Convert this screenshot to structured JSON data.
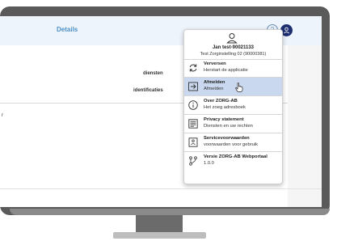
{
  "app": {
    "title": "Details"
  },
  "header": {
    "help_label": "?"
  },
  "content": {
    "label_diensten": "diensten",
    "label_identificaties": "identificaties",
    "partial_text": "r"
  },
  "menu": {
    "user": {
      "name": "Jan test-90021133",
      "organization": "Test Zorginstelling 02 (90000381)"
    },
    "items": [
      {
        "icon": "refresh-icon",
        "title": "Verversen",
        "subtitle": "Herstart de applicatie"
      },
      {
        "icon": "logout-icon",
        "title": "Afmelden",
        "subtitle": "Afmelden"
      },
      {
        "icon": "info-icon",
        "title": "Over ZORG-AB",
        "subtitle": "Het zoeg adresboek"
      },
      {
        "icon": "document-icon",
        "title": "Privacy statement",
        "subtitle": "Diensten en uw rechten"
      },
      {
        "icon": "terms-icon",
        "title": "Servicevoorwaarden",
        "subtitle": "voorwaarden voor gebruik"
      },
      {
        "icon": "version-branch-icon",
        "title": "Versie ZORG-AB Webportaal",
        "subtitle": "1.0.0"
      }
    ]
  },
  "colors": {
    "header_bg": "#eef4fb",
    "title": "#4a90c8",
    "highlight": "#c9d8ef",
    "avatar": "#1d2f6f"
  }
}
